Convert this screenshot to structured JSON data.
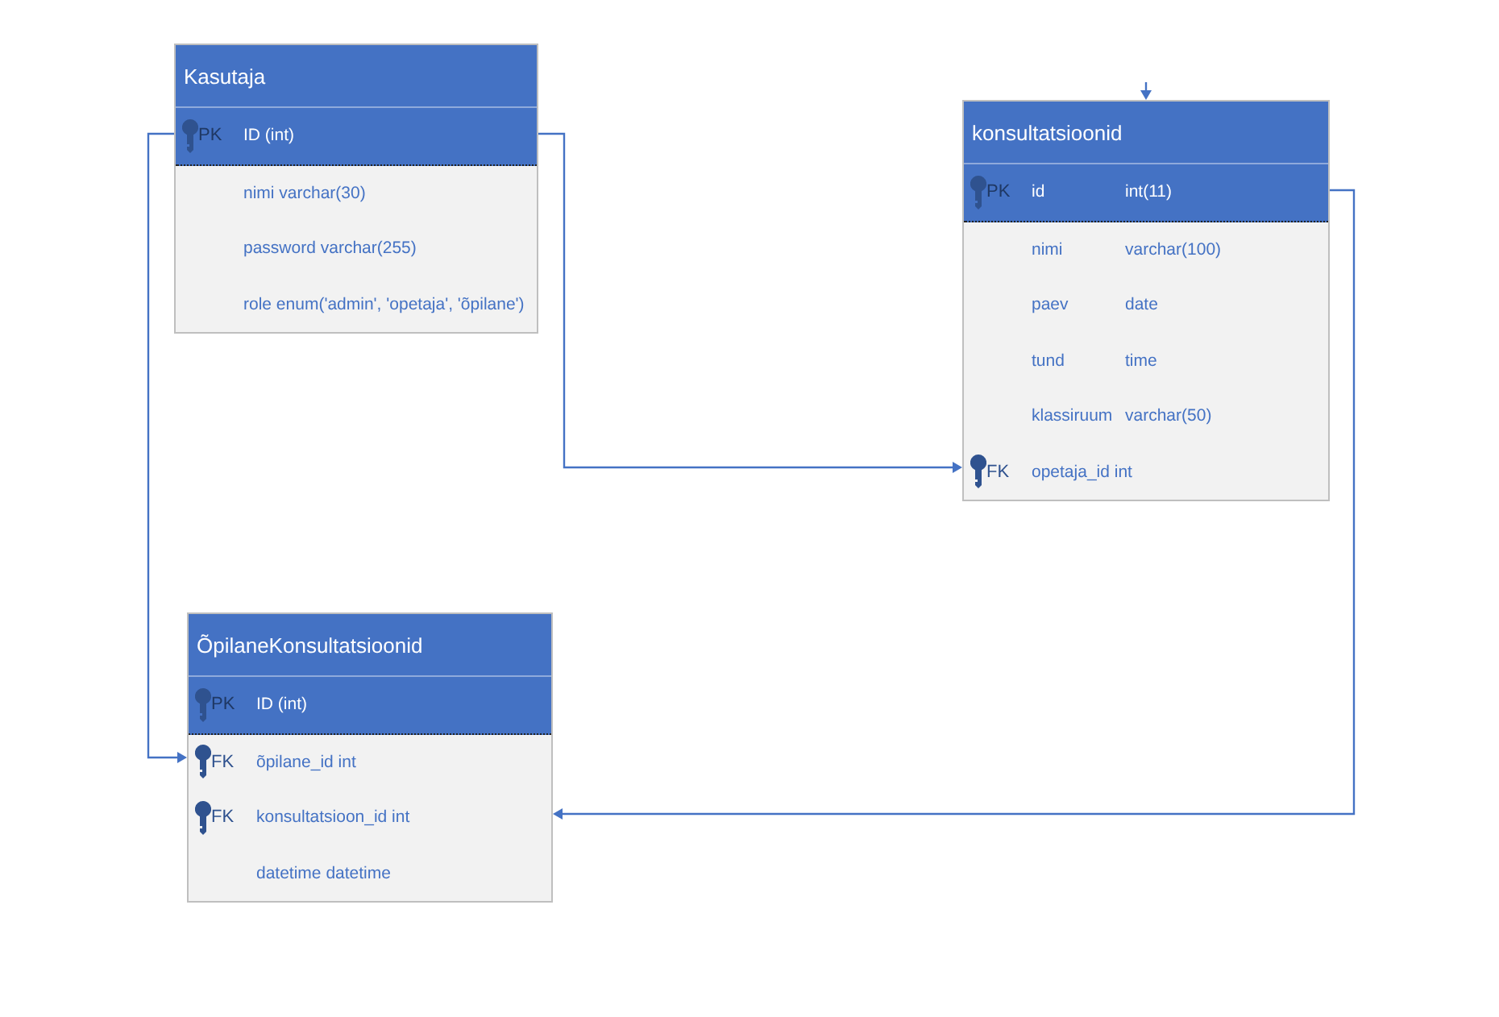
{
  "tables": [
    {
      "title": "Kasutaja",
      "rows": [
        {
          "key": "PK",
          "name": "ID (int)",
          "highlighted": true
        },
        {
          "name": "nimi varchar(30)",
          "highlighted": false
        },
        {
          "name": "password  varchar(255)",
          "highlighted": false
        },
        {
          "name": "role enum('admin', 'opetaja', 'õpilane')",
          "highlighted": false
        }
      ]
    },
    {
      "title": "konsultatsioonid",
      "rows": [
        {
          "key": "PK",
          "name": "id",
          "type": "int(11)",
          "highlighted": true
        },
        {
          "name": "nimi",
          "type": "varchar(100)",
          "highlighted": false
        },
        {
          "name": "paev",
          "type": "date",
          "highlighted": false
        },
        {
          "name": "tund",
          "type": "time",
          "highlighted": false
        },
        {
          "name": "klassiruum",
          "type": "varchar(50)",
          "highlighted": false
        },
        {
          "key": "FK",
          "name": "opetaja_id int",
          "highlighted": false
        }
      ]
    },
    {
      "title": "ÕpilaneKonsultatsioonid",
      "rows": [
        {
          "key": "PK",
          "name": "ID (int)",
          "highlighted": true
        },
        {
          "key": "FK",
          "name": "õpilane_id int",
          "highlighted": false
        },
        {
          "key": "FK",
          "name": "konsultatsioon_id int",
          "highlighted": false
        },
        {
          "name": "datetime datetime",
          "highlighted": false
        }
      ]
    }
  ]
}
